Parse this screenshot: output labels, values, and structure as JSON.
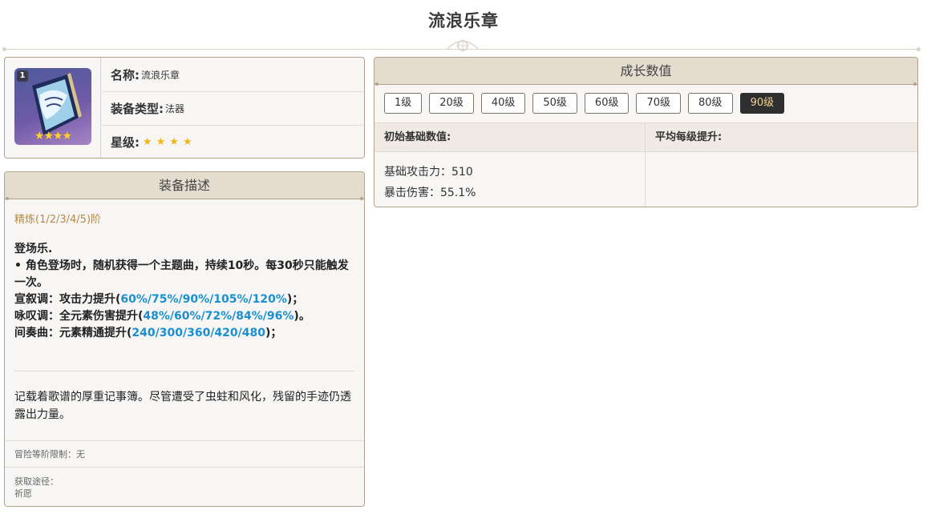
{
  "page": {
    "title": "流浪乐章"
  },
  "info": {
    "refine_badge": "1",
    "icon_stars": "★★★★",
    "name_label": "名称:",
    "name_value": "流浪乐章",
    "type_label": "装备类型:",
    "type_value": "法器",
    "rarity_label": "星级:",
    "rarity_stars": "★★★★",
    "rarity": 4
  },
  "description": {
    "header": "装备描述",
    "refine_title": "精炼(1/2/3/4/5)阶",
    "skill_name": "登场乐.",
    "line1": "• 角色登场时，随机获得一个主题曲，持续10秒。每30秒只能触发一次。",
    "line2_prefix": "宣叙调：攻击力提升(",
    "line2_values": "60%/75%/90%/105%/120%",
    "line2_suffix": ")；",
    "line3_prefix": "咏叹调：全元素伤害提升(",
    "line3_values": "48%/60%/72%/84%/96%",
    "line3_suffix": ")。",
    "line4_prefix": "间奏曲：元素精通提升(",
    "line4_values": "240/300/360/420/480",
    "line4_suffix": ")；",
    "lore": "记载着歌谱的厚重记事簿。尽管遭受了虫蛀和风化，残留的手迹仍透露出力量。",
    "rank_limit": "冒险等阶限制：无",
    "source_label": "获取途径：",
    "source_value": "祈愿"
  },
  "growth": {
    "header": "成长数值",
    "levels": [
      "1级",
      "20级",
      "40级",
      "50级",
      "60级",
      "70级",
      "80级",
      "90级"
    ],
    "active_level": "90级",
    "col_base": "初始基础数值:",
    "col_per_level": "平均每级提升:",
    "stat1": "基础攻击力：510",
    "stat2": "暴击伤害：55.1%"
  },
  "colors": {
    "accent": "#1a8fd1",
    "refine": "#b58a4a",
    "active_bg": "#2f2f2f",
    "active_text": "#f2d293",
    "header_bg": "#e4dccf"
  }
}
